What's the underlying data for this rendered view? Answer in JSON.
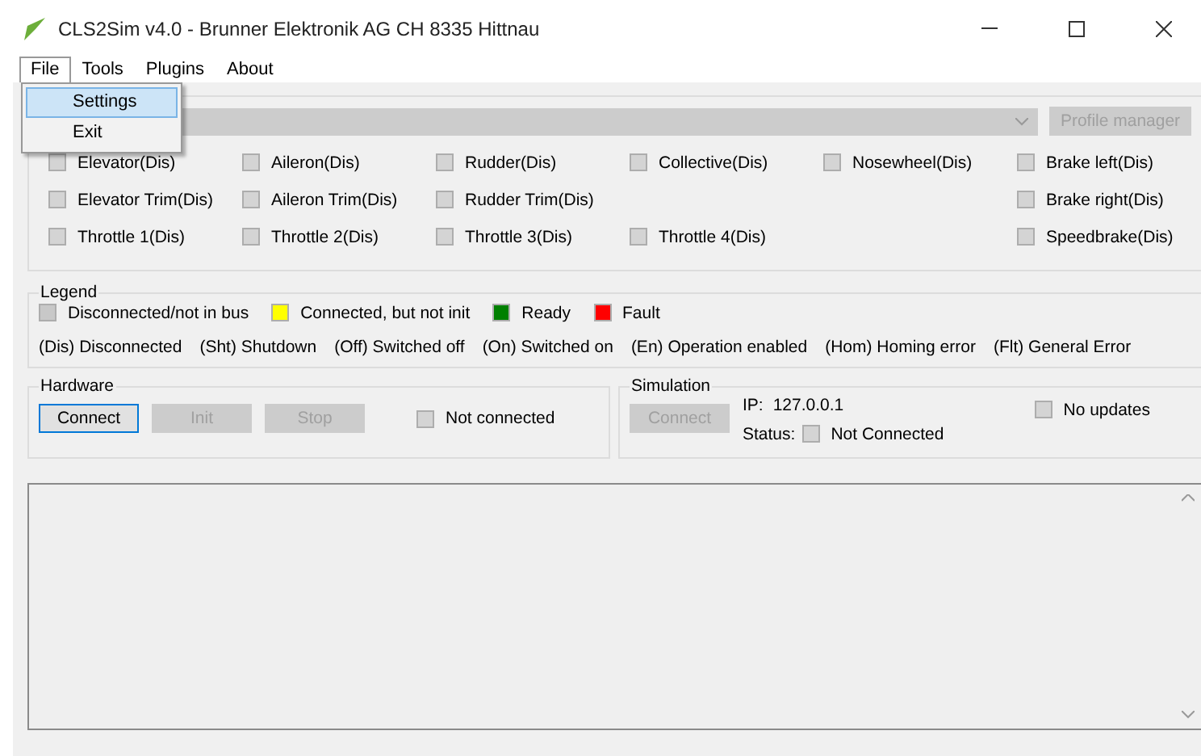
{
  "window": {
    "title": "CLS2Sim v4.0 - Brunner Elektronik AG CH 8335 Hittnau"
  },
  "menu": [
    {
      "label": "File",
      "selected": true
    },
    {
      "label": "Tools",
      "selected": false
    },
    {
      "label": "Plugins",
      "selected": false
    },
    {
      "label": "About",
      "selected": false
    }
  ],
  "open_menu": {
    "items": [
      {
        "label": "Settings",
        "selected": true
      },
      {
        "label": "Exit",
        "selected": false
      }
    ]
  },
  "profile": {
    "profile_button": "Profile manager",
    "axes": [
      [
        {
          "kind": "axis",
          "label": "Elevator(Dis)",
          "checked": false
        },
        {
          "kind": "axis",
          "label": "Aileron(Dis)",
          "checked": false
        },
        {
          "kind": "axis",
          "label": "Rudder(Dis)",
          "checked": false
        },
        {
          "kind": "axis",
          "label": "Collective(Dis)",
          "checked": false
        },
        {
          "kind": "axis",
          "label": "Nosewheel(Dis)",
          "checked": false
        },
        {
          "kind": "axis",
          "label": "Brake left(Dis)",
          "checked": false
        }
      ],
      [
        {
          "kind": "axis",
          "label": "Elevator Trim(Dis)",
          "checked": false
        },
        {
          "kind": "axis",
          "label": "Aileron Trim(Dis)",
          "checked": false
        },
        {
          "kind": "axis",
          "label": "Rudder Trim(Dis)",
          "checked": false
        },
        {
          "kind": "empty"
        },
        {
          "kind": "empty"
        },
        {
          "kind": "axis",
          "label": "Brake right(Dis)",
          "checked": false
        }
      ],
      [
        {
          "kind": "axis",
          "label": "Throttle 1(Dis)",
          "checked": false
        },
        {
          "kind": "axis",
          "label": "Throttle 2(Dis)",
          "checked": false
        },
        {
          "kind": "axis",
          "label": "Throttle 3(Dis)",
          "checked": false
        },
        {
          "kind": "axis",
          "label": "Throttle 4(Dis)",
          "checked": false
        },
        {
          "kind": "empty"
        },
        {
          "kind": "axis",
          "label": "Speedbrake(Dis)",
          "checked": false
        }
      ]
    ]
  },
  "legend": {
    "title": "Legend",
    "colors": [
      {
        "label": "Disconnected/not in bus",
        "color": "#c8c8c8"
      },
      {
        "label": "Connected, but not init",
        "color": "#ffff00"
      },
      {
        "label": "Ready",
        "color": "#008000"
      },
      {
        "label": "Fault",
        "color": "#ff0000"
      }
    ],
    "codes": [
      "(Dis) Disconnected",
      "(Sht) Shutdown",
      "(Off) Switched off",
      "(On) Switched on",
      "(En) Operation enabled",
      "(Hom) Homing error",
      "(Flt) General Error"
    ]
  },
  "hardware": {
    "title": "Hardware",
    "buttons": [
      {
        "label": "Connect",
        "disabled": false
      },
      {
        "label": "Init",
        "disabled": true
      },
      {
        "label": "Stop",
        "disabled": true
      }
    ],
    "status": "Not connected"
  },
  "simulation": {
    "title": "Simulation",
    "button": {
      "label": "Connect",
      "disabled": true
    },
    "ip_label": "IP:",
    "ip": "127.0.0.1",
    "status_label": "Status:",
    "status": "Not Connected",
    "no_updates": {
      "label": "No updates",
      "checked": false
    }
  }
}
